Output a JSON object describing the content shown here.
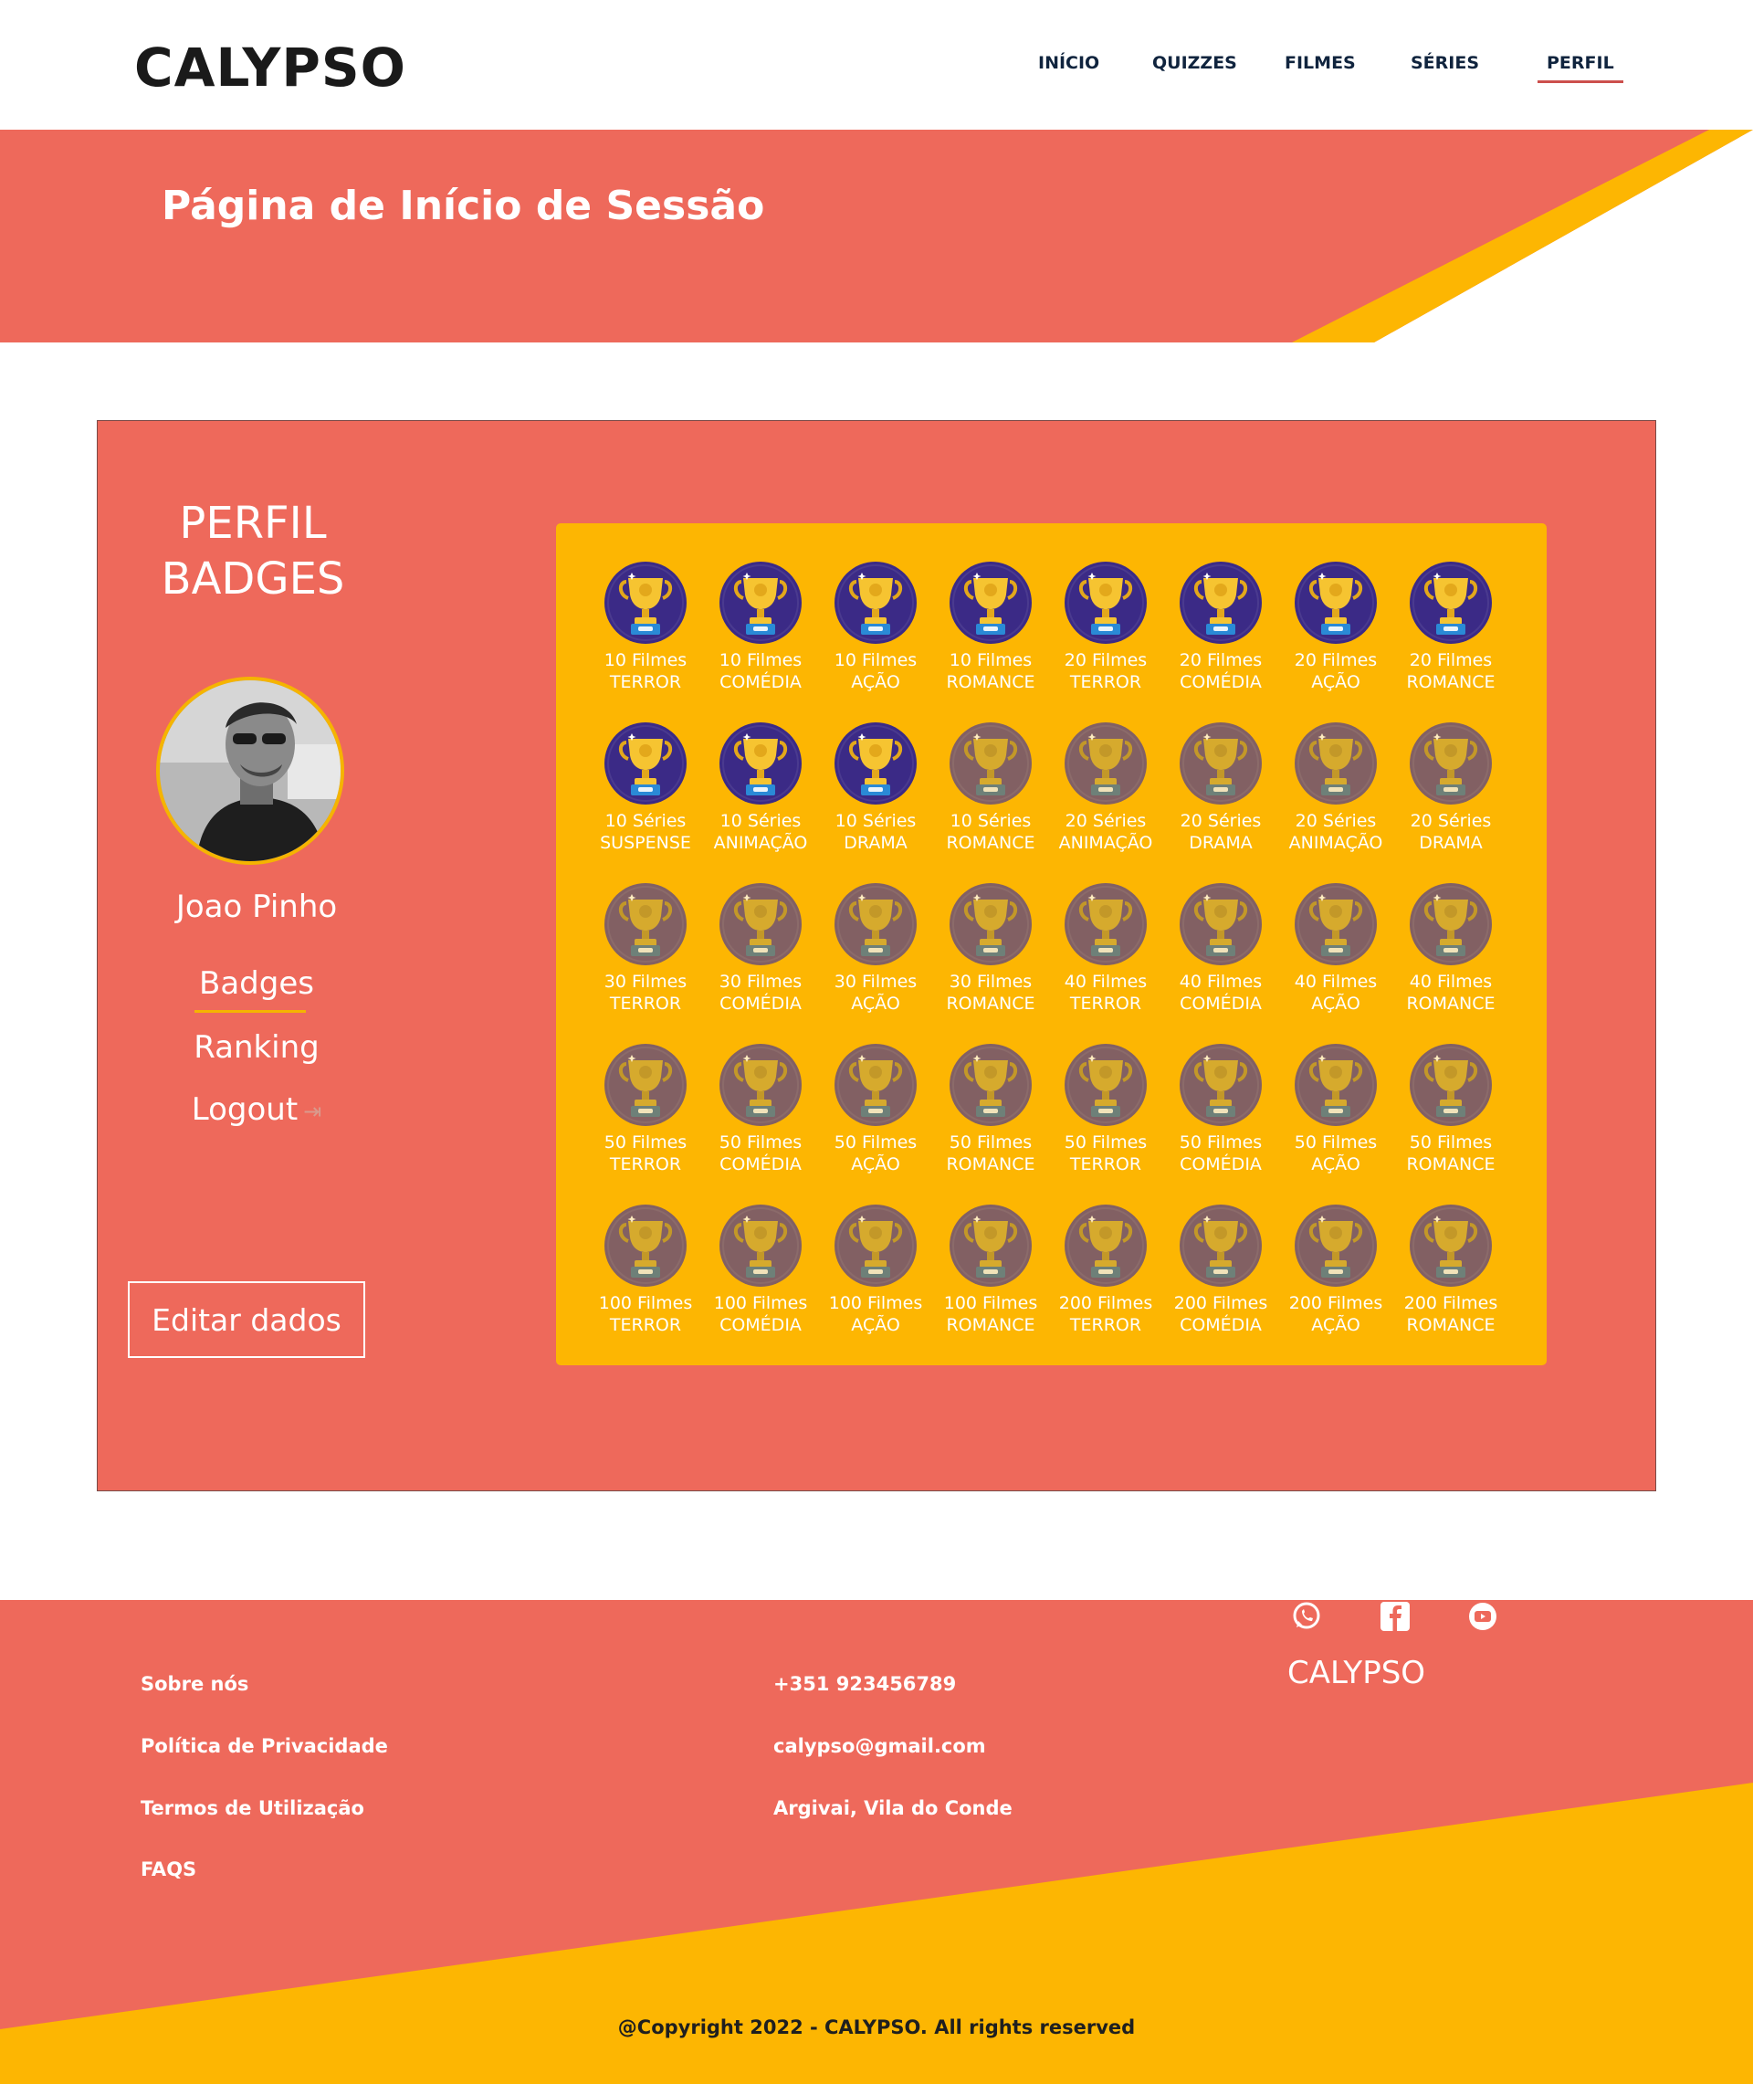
{
  "header": {
    "logo": "CALYPSO",
    "nav": [
      {
        "label": "INÍCIO"
      },
      {
        "label": "QUIZZES"
      },
      {
        "label": "FILMES"
      },
      {
        "label": "SÉRIES"
      },
      {
        "label": "PERFIL"
      }
    ]
  },
  "banner": {
    "title": "Página de Início de Sessão"
  },
  "profile": {
    "title_line1": "PERFIL",
    "title_line2": "BADGES",
    "username": "Joao Pinho",
    "links": {
      "badges": "Badges",
      "ranking": "Ranking",
      "logout": "Logout"
    },
    "edit_button": "Editar dados"
  },
  "badges": [
    {
      "line1": "10 Filmes",
      "line2": "TERROR",
      "earned": true
    },
    {
      "line1": "10 Filmes",
      "line2": "COMÉDIA",
      "earned": true
    },
    {
      "line1": "10 Filmes",
      "line2": "AÇÃO",
      "earned": true
    },
    {
      "line1": "10 Filmes",
      "line2": "ROMANCE",
      "earned": true
    },
    {
      "line1": "20 Filmes",
      "line2": "TERROR",
      "earned": true
    },
    {
      "line1": "20 Filmes",
      "line2": "COMÉDIA",
      "earned": true
    },
    {
      "line1": "20 Filmes",
      "line2": "AÇÃO",
      "earned": true
    },
    {
      "line1": "20 Filmes",
      "line2": "ROMANCE",
      "earned": true
    },
    {
      "line1": "10 Séries",
      "line2": "SUSPENSE",
      "earned": true
    },
    {
      "line1": "10 Séries",
      "line2": "ANIMAÇÃO",
      "earned": true
    },
    {
      "line1": "10 Séries",
      "line2": "DRAMA",
      "earned": true
    },
    {
      "line1": "10 Séries",
      "line2": "ROMANCE",
      "earned": false
    },
    {
      "line1": "20 Séries",
      "line2": "ANIMAÇÃO",
      "earned": false
    },
    {
      "line1": "20 Séries",
      "line2": "DRAMA",
      "earned": false
    },
    {
      "line1": "20 Séries",
      "line2": "ANIMAÇÃO",
      "earned": false
    },
    {
      "line1": "20 Séries",
      "line2": "DRAMA",
      "earned": false
    },
    {
      "line1": "30 Filmes",
      "line2": "TERROR",
      "earned": false
    },
    {
      "line1": "30 Filmes",
      "line2": "COMÉDIA",
      "earned": false
    },
    {
      "line1": "30 Filmes",
      "line2": "AÇÃO",
      "earned": false
    },
    {
      "line1": "30 Filmes",
      "line2": "ROMANCE",
      "earned": false
    },
    {
      "line1": "40 Filmes",
      "line2": "TERROR",
      "earned": false
    },
    {
      "line1": "40 Filmes",
      "line2": "COMÉDIA",
      "earned": false
    },
    {
      "line1": "40 Filmes",
      "line2": "AÇÃO",
      "earned": false
    },
    {
      "line1": "40 Filmes",
      "line2": "ROMANCE",
      "earned": false
    },
    {
      "line1": "50 Filmes",
      "line2": "TERROR",
      "earned": false
    },
    {
      "line1": "50 Filmes",
      "line2": "COMÉDIA",
      "earned": false
    },
    {
      "line1": "50 Filmes",
      "line2": "AÇÃO",
      "earned": false
    },
    {
      "line1": "50 Filmes",
      "line2": "ROMANCE",
      "earned": false
    },
    {
      "line1": "50 Filmes",
      "line2": "TERROR",
      "earned": false
    },
    {
      "line1": "50 Filmes",
      "line2": "COMÉDIA",
      "earned": false
    },
    {
      "line1": "50 Filmes",
      "line2": "AÇÃO",
      "earned": false
    },
    {
      "line1": "50 Filmes",
      "line2": "ROMANCE",
      "earned": false
    },
    {
      "line1": "100 Filmes",
      "line2": "TERROR",
      "earned": false
    },
    {
      "line1": "100 Filmes",
      "line2": "COMÉDIA",
      "earned": false
    },
    {
      "line1": "100 Filmes",
      "line2": "AÇÃO",
      "earned": false
    },
    {
      "line1": "100 Filmes",
      "line2": "ROMANCE",
      "earned": false
    },
    {
      "line1": "200 Filmes",
      "line2": "TERROR",
      "earned": false
    },
    {
      "line1": "200 Filmes",
      "line2": "COMÉDIA",
      "earned": false
    },
    {
      "line1": "200 Filmes",
      "line2": "AÇÃO",
      "earned": false
    },
    {
      "line1": "200 Filmes",
      "line2": "ROMANCE",
      "earned": false
    }
  ],
  "footer": {
    "col1": [
      "Sobre nós",
      "Política de Privacidade",
      "Termos de Utilização",
      "FAQS"
    ],
    "col2": [
      "+351 923456789",
      "calypso@gmail.com",
      "Argivai, Vila do Conde"
    ],
    "brand": "CALYPSO",
    "social_icons": [
      "whatsapp-icon",
      "facebook-icon",
      "youtube-icon"
    ],
    "copyright": "@Copyright 2022 - CALYPSO. All rights reserved"
  },
  "colors": {
    "coral": "#ee695b",
    "yellow": "#fdb602",
    "trophy_bg": "#3b2a86",
    "dark_text": "#10243e"
  }
}
